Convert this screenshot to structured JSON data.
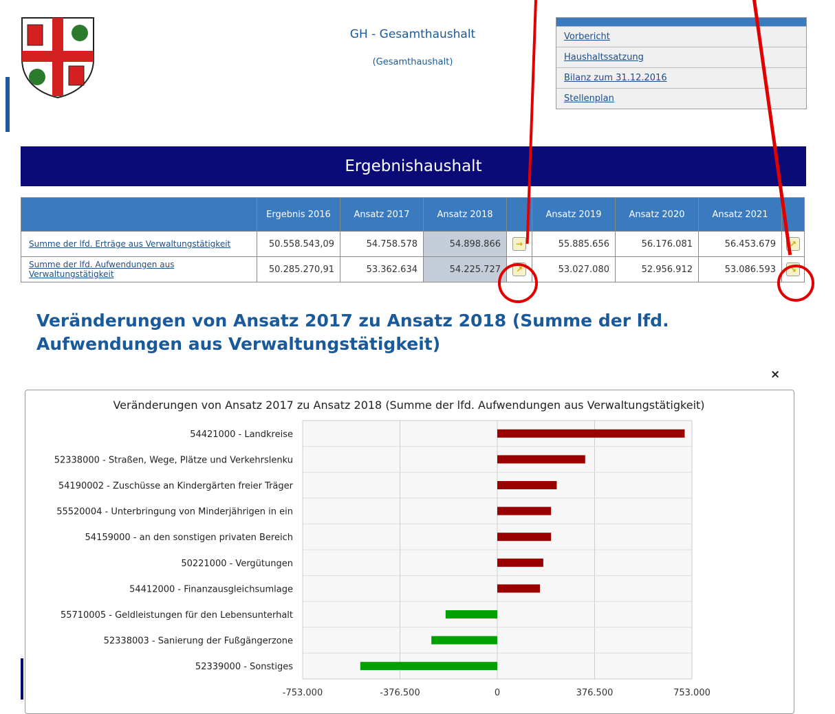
{
  "header": {
    "title": "GH - Gesamthaushalt",
    "subtitle": "(Gesamthaushalt)"
  },
  "sidebar_links": [
    "Vorbericht",
    "Haushaltssatzung",
    "Bilanz zum 31.12.2016",
    "Stellenplan"
  ],
  "section_title": "Ergebnishaushalt",
  "table": {
    "columns": [
      "Ergebnis 2016",
      "Ansatz 2017",
      "Ansatz 2018",
      "Ansatz 2019",
      "Ansatz 2020",
      "Ansatz 2021"
    ],
    "rows": [
      {
        "label": "Summe der lfd. Erträge aus Verwaltungstätigkeit",
        "values": [
          "50.558.543,09",
          "54.758.578",
          "54.898.866",
          "55.885.656",
          "56.176.081",
          "56.453.679"
        ],
        "arrow1": "→",
        "arrow2": "↗"
      },
      {
        "label": "Summe der lfd. Aufwendungen aus Verwaltungstätigkeit",
        "values": [
          "50.285.270,91",
          "53.362.634",
          "54.225.727",
          "53.027.080",
          "52.956.912",
          "53.086.593"
        ],
        "arrow1": "↗",
        "arrow2": "↘"
      }
    ]
  },
  "modal": {
    "title": "Veränderungen von Ansatz 2017 zu Ansatz 2018 (Summe der lfd. Aufwendungen aus Verwaltungstätigkeit)",
    "close": "×"
  },
  "colors": {
    "increase": "#990000",
    "decrease": "#00a000",
    "header": "#3a7bbf",
    "banner": "#0a0a78"
  },
  "chart_data": {
    "type": "bar",
    "orientation": "horizontal",
    "title": "Veränderungen von Ansatz 2017 zu Ansatz 2018 (Summe der lfd. Aufwendungen aus Verwaltungstätigkeit)",
    "categories": [
      "54421000 - Landkreise",
      "52338000 - Straßen, Wege, Plätze und Verkehrslenku",
      "54190002 - Zuschüsse an Kindergärten freier Träger",
      "55520004 - Unterbringung von Minderjährigen in ein",
      "54159000 - an den sonstigen privaten Bereich",
      "50221000 - Vergütungen",
      "54412000 - Finanzausgleichsumlage",
      "55710005 - Geldleistungen für den Lebensunterhalt",
      "52338003 - Sanierung der Fußgängerzone",
      "52339000 - Sonstiges"
    ],
    "values": [
      725000,
      340000,
      230000,
      208000,
      208000,
      178000,
      165000,
      -200000,
      -255000,
      -530000
    ],
    "xlim": [
      -753000,
      753000
    ],
    "xticks": [
      "-753.000",
      "-376.500",
      "0",
      "376.500",
      "753.000"
    ],
    "grid": true
  }
}
